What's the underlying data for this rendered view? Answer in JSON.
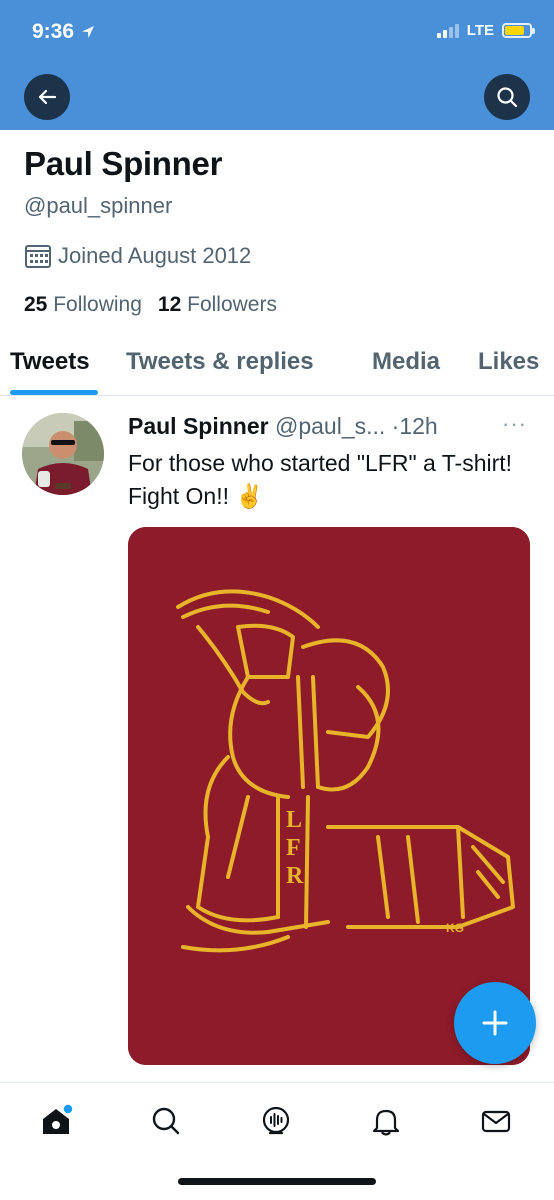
{
  "status_bar": {
    "time": "9:36",
    "network": "LTE",
    "battery_level": 0.8,
    "battery_color": "#ffd60a"
  },
  "header": {
    "color": "#4a90d9",
    "back_icon": "arrow-left-icon",
    "search_icon": "search-icon"
  },
  "profile": {
    "display_name": "Paul Spinner",
    "handle": "@paul_spinner",
    "joined": "Joined August 2012",
    "following_count": "25",
    "following_label": "Following",
    "followers_count": "12",
    "followers_label": "Followers"
  },
  "tabs": [
    {
      "label": "Tweets",
      "active": true
    },
    {
      "label": "Tweets & replies",
      "active": false
    },
    {
      "label": "Media",
      "active": false
    },
    {
      "label": "Likes",
      "active": false
    }
  ],
  "tweet": {
    "author_name": "Paul Spinner",
    "author_handle": "@paul_s...",
    "separator": "·",
    "time": "12h",
    "more": "···",
    "text": "For those who started \"LFR\" a T-shirt! Fight On!! ✌️",
    "media_letters": [
      "L",
      "F",
      "R"
    ],
    "media_signature": "KG",
    "media_colors": {
      "shirt": "#8e1b2a",
      "ink": "#e8b52a"
    }
  },
  "fab_icon": "plus-icon",
  "bottom_nav": [
    {
      "icon": "home-icon",
      "active": true,
      "has_dot": true
    },
    {
      "icon": "search-icon",
      "active": false
    },
    {
      "icon": "spaces-icon",
      "active": false
    },
    {
      "icon": "bell-icon",
      "active": false
    },
    {
      "icon": "mail-icon",
      "active": false
    }
  ],
  "accent": "#1d9bf0"
}
